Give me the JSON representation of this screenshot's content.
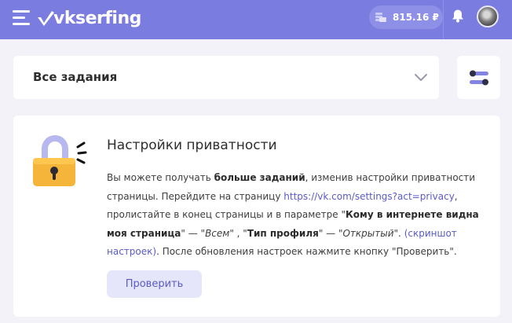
{
  "header": {
    "logo_text": "vkserfing",
    "balance": "815.16 ₽",
    "icons": [
      "menu-icon",
      "coins-icon",
      "bell-icon",
      "avatar"
    ]
  },
  "filter": {
    "selected": "Все задания"
  },
  "card": {
    "title": "Настройки приватности",
    "text_1": "Вы можете получать ",
    "bold_1": "больше заданий",
    "text_2": ", изменив настройки приватности страницы. Перейдите на страницу ",
    "link_1": "https://vk.com/settings?act=privacy",
    "text_3": ", пролистайте в конец страницы и в параметре \"",
    "bold_2": "Кому в интернете видна моя страница",
    "text_4": "\" — \"",
    "italic_1": "Всем",
    "text_5": "\" , \"",
    "bold_3": "Тип профиля",
    "text_6": "\" — \"",
    "italic_2": "Открытый",
    "text_7": "\". ",
    "link_2": "(скриншот настроек)",
    "text_8": ". После обновления настроек нажмите кнопку \"Проверить\".",
    "button": "Проверить"
  },
  "colors": {
    "header": "#7b7ce0",
    "accent": "#5a5bc7",
    "button_bg": "#e6e6fa",
    "lock_body": "#f5b43a",
    "lock_shackle": "#b7b8f0"
  }
}
